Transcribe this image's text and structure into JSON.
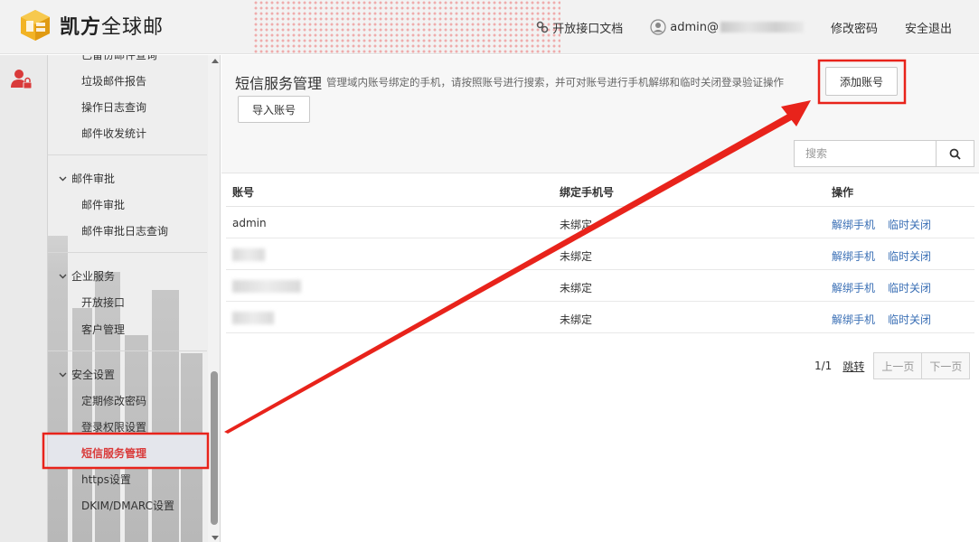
{
  "header": {
    "logo_text_bold": "凯方",
    "logo_text_light": "全球邮",
    "api_docs": "开放接口文档",
    "user": "admin@",
    "change_password": "修改密码",
    "logout": "安全退出"
  },
  "sidebar": {
    "items": [
      {
        "label": "已备份邮件查询"
      },
      {
        "label": "垃圾邮件报告"
      },
      {
        "label": "操作日志查询"
      },
      {
        "label": "邮件收发统计"
      }
    ],
    "groups": [
      {
        "label": "邮件审批",
        "items": [
          {
            "label": "邮件审批"
          },
          {
            "label": "邮件审批日志查询"
          }
        ]
      },
      {
        "label": "企业服务",
        "items": [
          {
            "label": "开放接口"
          },
          {
            "label": "客户管理"
          }
        ]
      },
      {
        "label": "安全设置",
        "items": [
          {
            "label": "定期修改密码"
          },
          {
            "label": "登录权限设置"
          },
          {
            "label": "短信服务管理"
          },
          {
            "label": "https设置"
          },
          {
            "label": "DKIM/DMARC设置"
          }
        ]
      }
    ]
  },
  "main": {
    "title": "短信服务管理",
    "description": "管理域内账号绑定的手机，请按照账号进行搜索，并可对账号进行手机解绑和临时关闭登录验证操作",
    "import_button": "导入账号",
    "add_button": "添加账号",
    "search_placeholder": "搜索"
  },
  "table": {
    "columns": [
      "账号",
      "绑定手机号",
      "操作"
    ],
    "rows": [
      {
        "account": "admin",
        "phone": "未绑定",
        "unbind": "解绑手机",
        "close": "临时关闭"
      },
      {
        "account": "",
        "phone": "未绑定",
        "unbind": "解绑手机",
        "close": "临时关闭"
      },
      {
        "account": "",
        "phone": "未绑定",
        "unbind": "解绑手机",
        "close": "临时关闭"
      },
      {
        "account": "",
        "phone": "未绑定",
        "unbind": "解绑手机",
        "close": "临时关闭"
      }
    ]
  },
  "pager": {
    "info": "1/1",
    "jump": "跳转",
    "prev": "上一页",
    "next": "下一页"
  },
  "colors": {
    "accent_red": "#d93a3a",
    "link_blue": "#3a6fb5",
    "logo_yellow": "#f2b324",
    "annotation_red": "#e8231b"
  }
}
